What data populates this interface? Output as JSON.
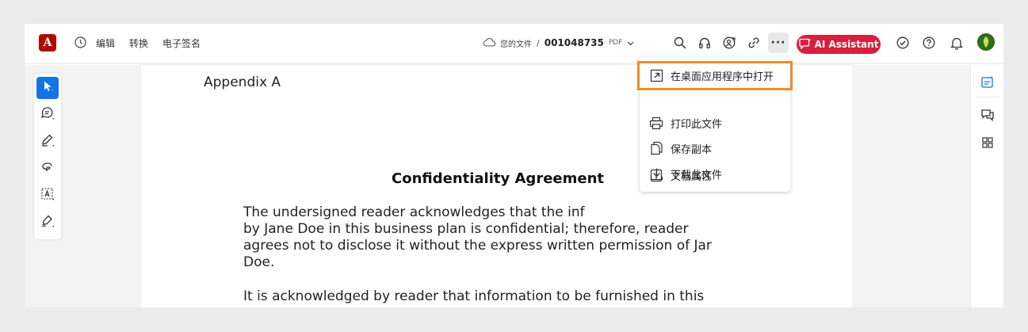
{
  "header": {
    "logo_letter": "A",
    "menu": {
      "edit": "编辑",
      "convert": "转换",
      "sign": "电子签名"
    },
    "breadcrumb": "您的文件",
    "separator": "/",
    "file_name": "001048735",
    "file_type": "PDF",
    "more_label": "···",
    "ai_label": "AI Assistant"
  },
  "icons": {
    "history": "clock-icon",
    "search": "search-icon",
    "listen": "headphones-icon",
    "share": "share-user-icon",
    "link": "link-icon",
    "more": "more-icon",
    "tasks": "check-circle-icon",
    "help": "help-icon",
    "notifications": "bell-icon"
  },
  "dropdown": {
    "items": [
      {
        "label": "在桌面应用程序中打开",
        "icon": "open-external-icon"
      },
      {
        "label": "打印此文件",
        "icon": "print-icon"
      },
      {
        "label": "保存副本",
        "icon": "copy-icon"
      },
      {
        "label": "下载此文件",
        "icon": "download-icon"
      },
      {
        "label": "文档属性",
        "icon": "info-icon"
      }
    ]
  },
  "document": {
    "appendix": "Appendix A",
    "title": "Confidentiality Agreement",
    "para1_lines": [
      "The undersigned reader acknowledges that the inf",
      "by Jane Doe in this business plan is confidential; therefore, reader",
      "agrees not to disclose it without the express written permission of Jar",
      "Doe."
    ],
    "para2_lines": [
      "It is acknowledged by reader that information to be furnished in this"
    ]
  },
  "colors": {
    "accent": "#1473e6",
    "ai": "#d81f3f",
    "highlight": "#f08b2a",
    "logo": "#b30b00"
  }
}
